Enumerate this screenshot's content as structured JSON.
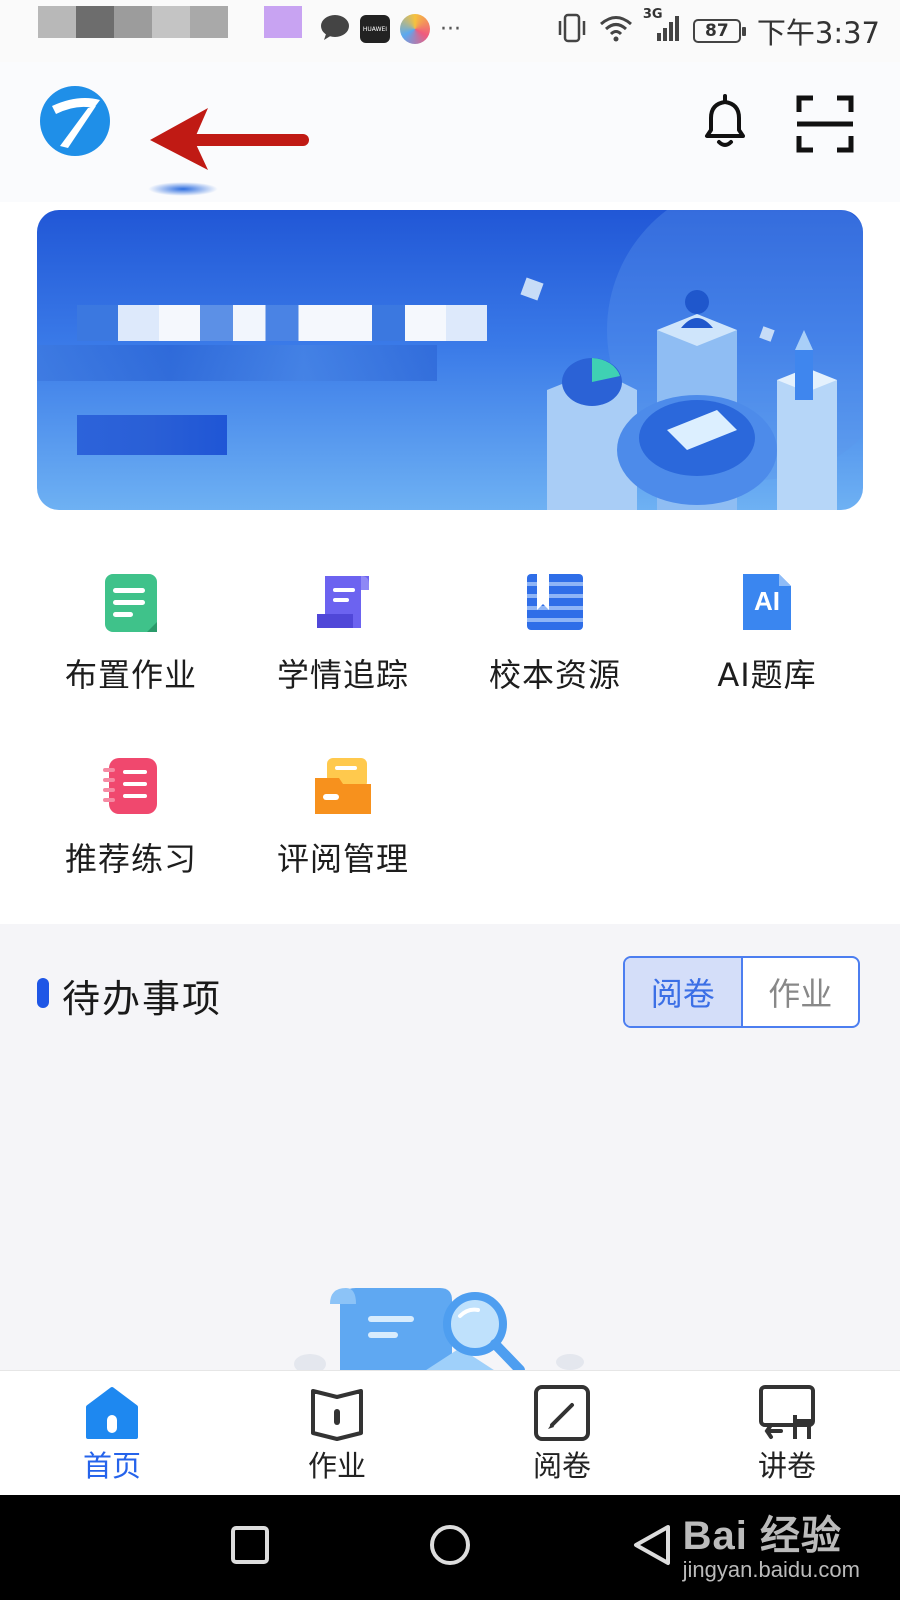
{
  "status_bar": {
    "time": "下午3:37",
    "battery": "87",
    "network": "3G",
    "more": "···",
    "app_badge": "HUAWEI"
  },
  "header": {
    "logo_icon": "app-logo-icon",
    "notification_icon": "bell-icon",
    "scan_icon": "scan-icon"
  },
  "quick_actions": [
    {
      "label": "布置作业",
      "icon": "assign-homework-icon",
      "color": "#3fc28a"
    },
    {
      "label": "学情追踪",
      "icon": "learning-tracking-icon",
      "color": "#6c63f0"
    },
    {
      "label": "校本资源",
      "icon": "school-resources-icon",
      "color": "#2f6ee8"
    },
    {
      "label": "AI题库",
      "icon": "ai-question-bank-icon",
      "icon_text": "AI",
      "color": "#3a86f0"
    },
    {
      "label": "推荐练习",
      "icon": "recommended-practice-icon",
      "color": "#f0486e"
    },
    {
      "label": "评阅管理",
      "icon": "review-management-icon",
      "color": "#f7911d"
    }
  ],
  "todo": {
    "title": "待办事项",
    "tabs": [
      {
        "label": "阅卷",
        "active": true
      },
      {
        "label": "作业",
        "active": false
      }
    ]
  },
  "bottom_nav": [
    {
      "label": "首页",
      "icon": "home-icon",
      "active": true
    },
    {
      "label": "作业",
      "icon": "homework-icon",
      "active": false
    },
    {
      "label": "阅卷",
      "icon": "grading-icon",
      "active": false
    },
    {
      "label": "讲卷",
      "icon": "lecture-icon",
      "active": false
    }
  ],
  "watermark": {
    "main": "Bai  经验",
    "sub": "jingyan.baidu.com"
  },
  "colors": {
    "accent": "#2563eb",
    "banner_top": "#2157d6",
    "banner_bottom": "#6eb1f3",
    "arrow": "#c01a14"
  }
}
